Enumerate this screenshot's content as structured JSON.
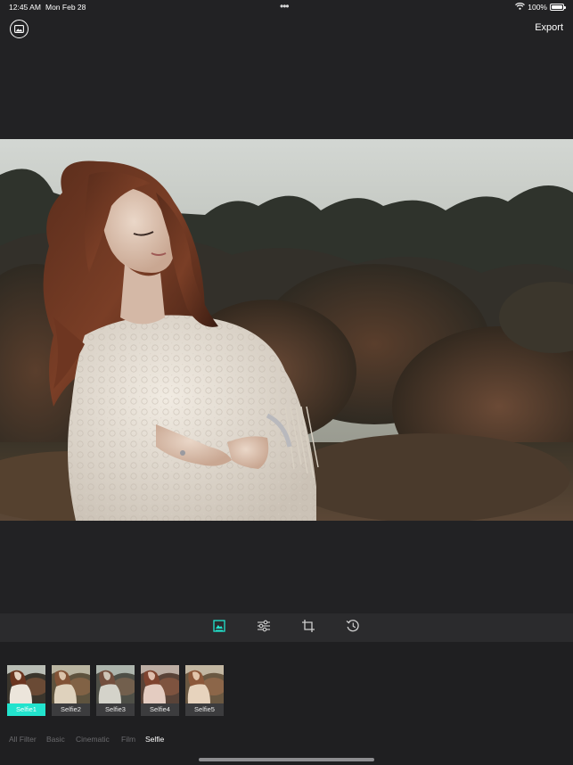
{
  "status_bar": {
    "time": "12:45 AM",
    "date": "Mon Feb 28",
    "multitask": "•••",
    "battery_text": "100%",
    "battery_level": 1.0
  },
  "top_bar": {
    "gallery_icon": "photo-gallery-icon",
    "export_label": "Export"
  },
  "toolbar": {
    "tools": [
      {
        "name": "filters",
        "icon": "image-filter-icon",
        "active": true
      },
      {
        "name": "adjust",
        "icon": "sliders-icon",
        "active": false
      },
      {
        "name": "crop",
        "icon": "crop-icon",
        "active": false
      },
      {
        "name": "history",
        "icon": "history-icon",
        "active": false
      }
    ],
    "accent_color": "#22e3cd"
  },
  "filters": {
    "items": [
      {
        "label": "Selfie1",
        "active": true
      },
      {
        "label": "Selfie2",
        "active": false
      },
      {
        "label": "Selfie3",
        "active": false
      },
      {
        "label": "Selfie4",
        "active": false
      },
      {
        "label": "Selfie5",
        "active": false
      }
    ],
    "categories": [
      {
        "label": "All Filter",
        "active": false
      },
      {
        "label": "Basic",
        "active": false
      },
      {
        "label": "Cinematic",
        "active": false
      },
      {
        "label": "Film",
        "active": false
      },
      {
        "label": "Selfie",
        "active": true
      }
    ]
  },
  "colors": {
    "background": "#222224",
    "accent": "#22e3cd",
    "inactive_text": "#6b6b6e"
  }
}
